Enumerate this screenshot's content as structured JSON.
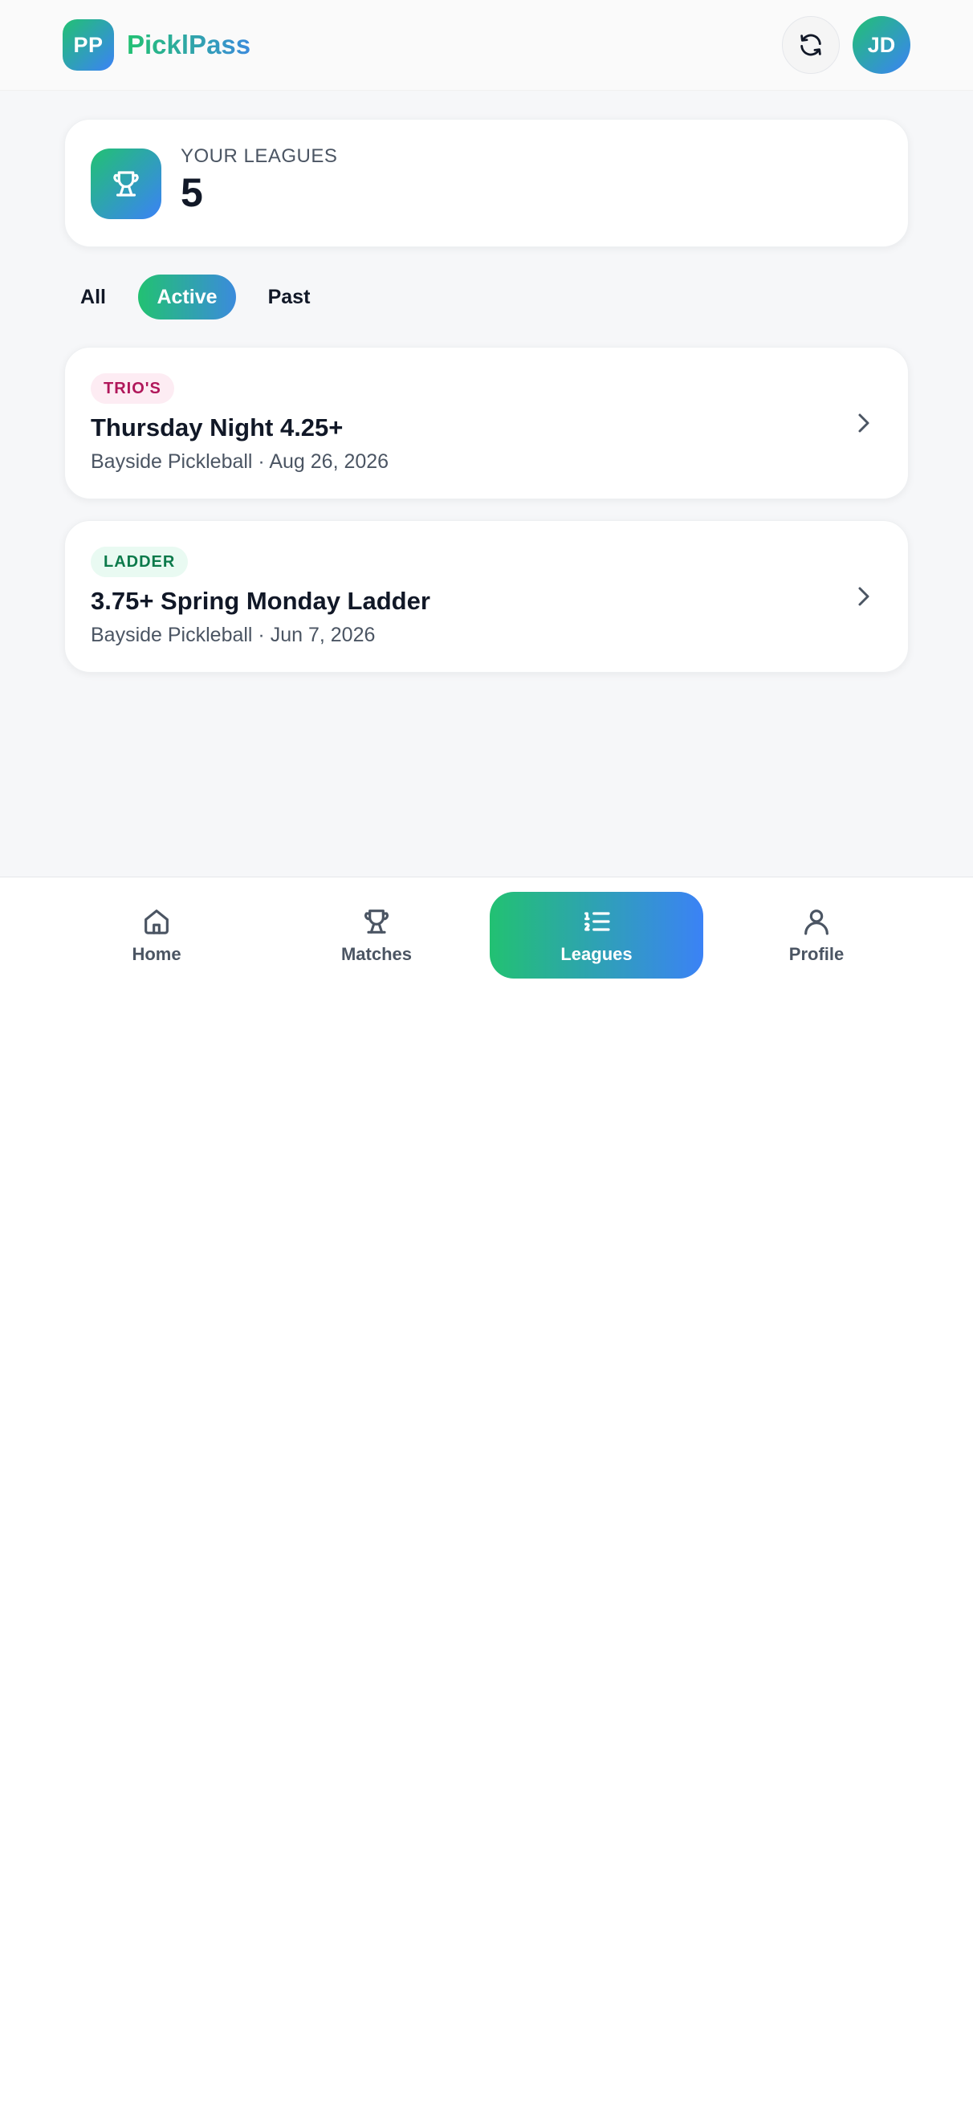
{
  "header": {
    "logo_initials": "PP",
    "app_name": "PicklPass",
    "avatar_initials": "JD"
  },
  "summary": {
    "label": "YOUR LEAGUES",
    "value": "5"
  },
  "filters": {
    "all": "All",
    "active": "Active",
    "past": "Past",
    "selected": "Active"
  },
  "leagues": [
    {
      "tag": "TRIO'S",
      "title": "Thursday Night 4.25+",
      "meta": "Bayside Pickleball · Aug 26, 2026"
    },
    {
      "tag": "LADDER",
      "title": "3.75+ Spring Monday Ladder",
      "meta": "Bayside Pickleball · Jun 7, 2026"
    }
  ],
  "nav": {
    "home": "Home",
    "matches": "Matches",
    "leagues": "Leagues",
    "profile": "Profile",
    "selected": "Leagues"
  },
  "icons": {
    "refresh": "refresh-icon",
    "trophy": "trophy-icon",
    "chevron": "chevron-right-icon",
    "home": "home-icon",
    "list": "ordered-list-icon",
    "user": "user-icon"
  },
  "colors": {
    "brand_green": "#22c172",
    "brand_blue": "#3b82f6",
    "trios_tag_bg": "#fdecf3",
    "trios_tag_text": "#b0175a",
    "ladder_tag_bg": "#e9faf2",
    "ladder_tag_text": "#0c7a4b"
  }
}
